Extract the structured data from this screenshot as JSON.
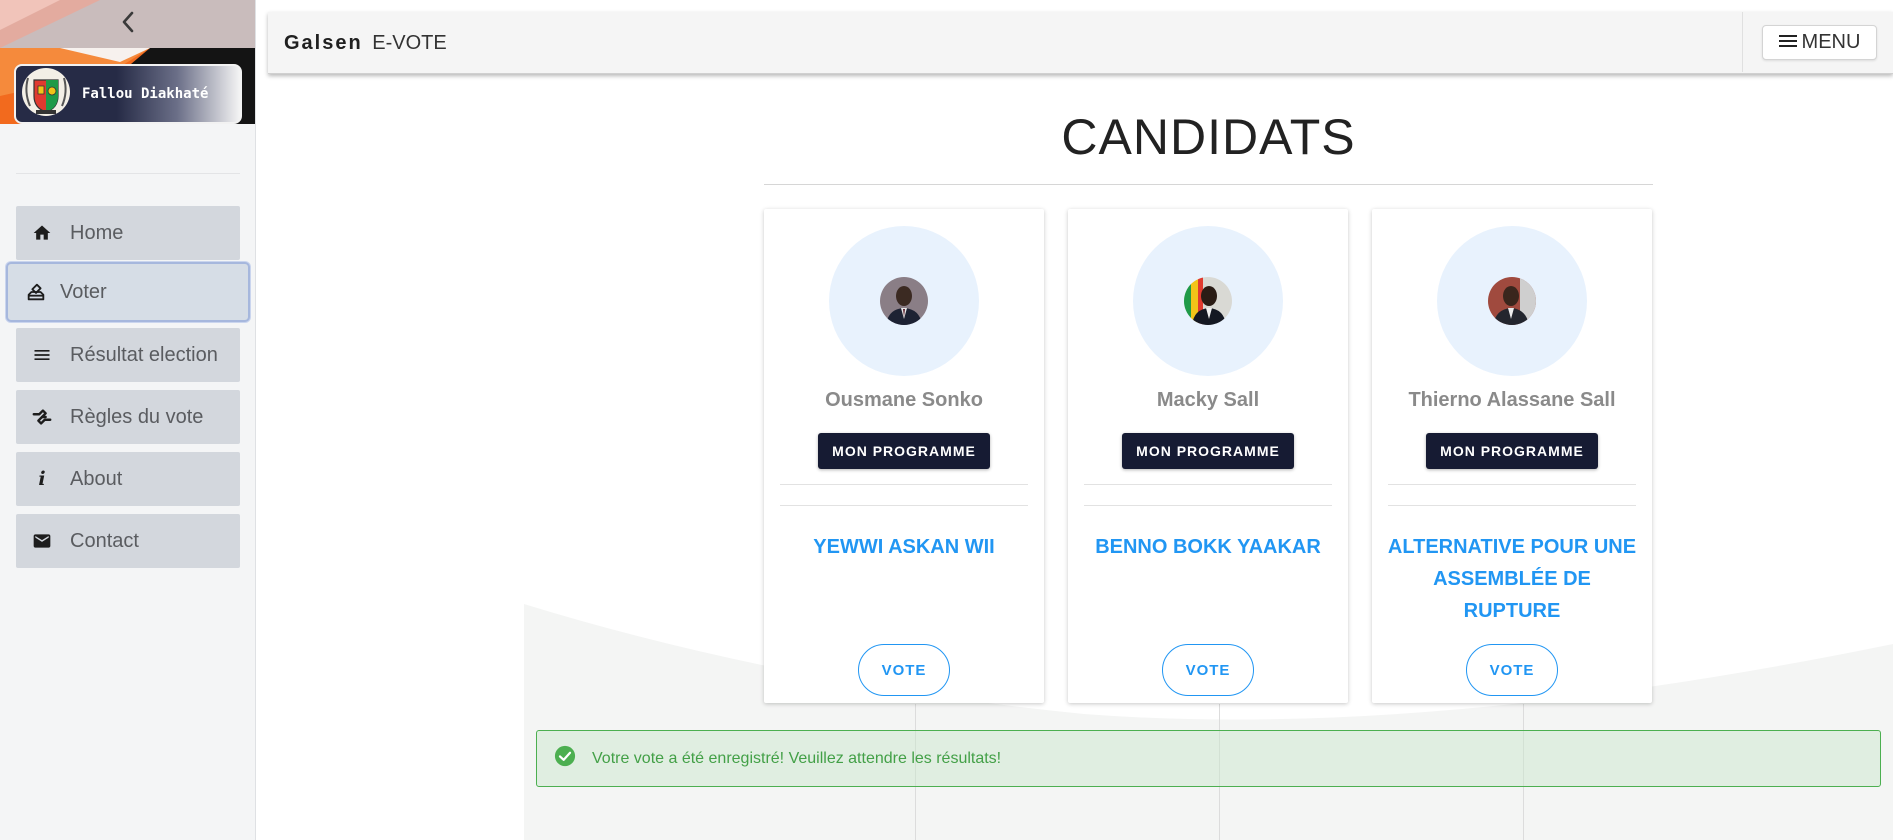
{
  "sidebar": {
    "profile_name": "Fallou Diakhaté",
    "items": [
      {
        "label": "Home",
        "icon": "home-icon"
      },
      {
        "label": "Voter",
        "icon": "ballot-icon"
      },
      {
        "label": "Résultat election",
        "icon": "list-icon"
      },
      {
        "label": "Règles du vote",
        "icon": "rules-icon"
      },
      {
        "label": "About",
        "icon": "info-icon"
      },
      {
        "label": "Contact",
        "icon": "mail-icon"
      }
    ],
    "active_item": "Voter"
  },
  "header": {
    "brand_strong": "Galsen",
    "brand_light": "E-VOTE",
    "menu_label": "MENU"
  },
  "main": {
    "title": "CANDIDATS",
    "candidates": [
      {
        "name": "Ousmane Sonko",
        "program_label": "MON PROGRAMME",
        "party": "YEWWI ASKAN WII",
        "vote_label": "VOTE"
      },
      {
        "name": "Macky Sall",
        "program_label": "MON PROGRAMME",
        "party": "BENNO BOKK YAAKAR",
        "vote_label": "VOTE"
      },
      {
        "name": "Thierno Alassane Sall",
        "program_label": "MON PROGRAMME",
        "party": "ALTERNATIVE POUR UNE ASSEMBLÉE DE RUPTURE",
        "vote_label": "VOTE"
      }
    ],
    "alert": {
      "message": "Votre vote a été enregistré! Veuillez attendre les résultats!",
      "type": "success",
      "icon": "check-circle-icon"
    }
  },
  "colors": {
    "accent": "#2196f3",
    "button_dark": "#161b33",
    "success": "#43a047",
    "sidebar_item_bg": "#d3d7dd"
  }
}
